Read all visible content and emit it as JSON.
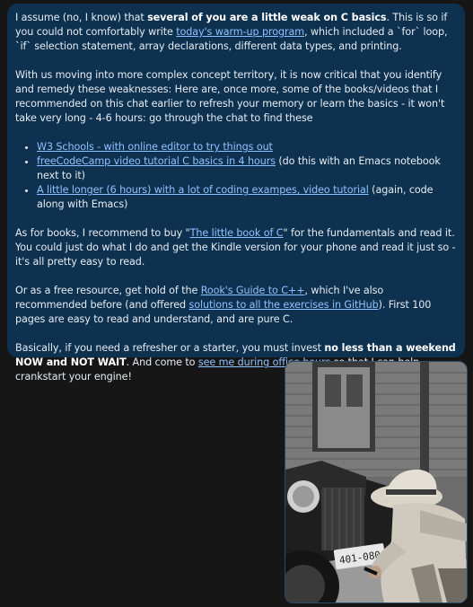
{
  "message": {
    "p1": {
      "t1": "I assume (no, I know) that ",
      "bold1": "several of you are a little weak on C basics",
      "t2": ". This is so if you could not comfortably write ",
      "link1": "today's warm-up program",
      "t3": ", which included a `for` loop, `if` selection statement, array declarations, different data types, and printing."
    },
    "p2": "With us moving into more complex concept territory, it is now critical that you identify and remedy these weaknesses: Here are, once more, some of the books/videos that I recommended on this chat earlier to refresh your memory or learn the basics - it won't take very long - 4-6 hours:  go through the chat to find these",
    "list": [
      {
        "link": "W3 Schools - with online editor to try things out",
        "suffix": ""
      },
      {
        "link": "freeCodeCamp video tutorial C basics in 4 hours",
        "suffix": " (do this with an Emacs notebook next to it)"
      },
      {
        "link": "A little longer (6 hours) with a lot of coding exampes, video tutorial",
        "suffix": " (again, code along with Emacs)"
      }
    ],
    "p3": {
      "t1": "As for books, I recommend to buy \"",
      "link1": "The little book of C",
      "t2": "\" for the fundamentals and read it. You could just do what I do and get the Kindle version for your phone and read it just so - it's all pretty easy to read."
    },
    "p4": {
      "t1": "Or as a free resource, get hold of the ",
      "link1": "Rook's Guide to C++",
      "t2": ", which I've also recommended before (and offered ",
      "link2": "solutions to all the exercises in GitHub",
      "t3": "). First 100 pages are easy to read and understand, and are pure C."
    },
    "p5": {
      "t1": "Basically, if you need a refresher or a starter, you must invest ",
      "bold1": "no less than a weekend NOW and NOT WAIT",
      "t2": ". And come to ",
      "link1": "see me during office hours",
      "t3": " so that I can help crankstart your engine!"
    }
  },
  "photo": {
    "plate_text": "401-080"
  },
  "colors": {
    "background": "#161616",
    "bubble": "#0e3150",
    "text": "#e6ecf2",
    "link": "#8fc1ff"
  }
}
